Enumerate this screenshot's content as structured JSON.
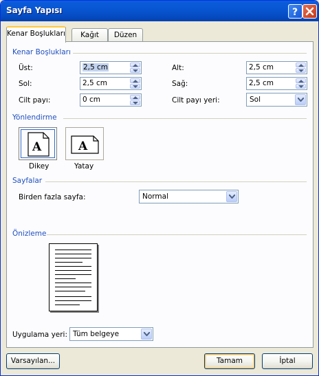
{
  "window": {
    "title": "Sayfa Yapısı"
  },
  "titlebar_buttons": {
    "help_glyph": "?",
    "close_glyph": "✕"
  },
  "tabs": [
    {
      "label": "Kenar Boşlukları",
      "active": true
    },
    {
      "label": "Kağıt",
      "active": false
    },
    {
      "label": "Düzen",
      "active": false
    }
  ],
  "margins": {
    "section_title": "Kenar Boşlukları",
    "top": {
      "label": "Üst:",
      "value": "2,5 cm"
    },
    "bottom": {
      "label": "Alt:",
      "value": "2,5 cm"
    },
    "left": {
      "label": "Sol:",
      "value": "2,5 cm"
    },
    "right": {
      "label": "Sağ:",
      "value": "2,5 cm"
    },
    "gutter": {
      "label": "Cilt payı:",
      "value": "0 cm"
    },
    "gutter_position": {
      "label": "Cilt payı yeri:",
      "value": "Sol"
    }
  },
  "orientation": {
    "section_title": "Yönlendirme",
    "portrait": {
      "label": "Dikey",
      "glyph": "A",
      "selected": true
    },
    "landscape": {
      "label": "Yatay",
      "glyph": "A",
      "selected": false
    }
  },
  "pages": {
    "section_title": "Sayfalar",
    "multiple_pages": {
      "label": "Birden fazla sayfa:",
      "value": "Normal"
    }
  },
  "preview": {
    "section_title": "Önizleme",
    "apply_to": {
      "label": "Uygulama yeri:",
      "value": "Tüm belgeye"
    }
  },
  "buttons": {
    "default_label": "Varsayılan...",
    "ok_label": "Tamam",
    "cancel_label": "İptal"
  },
  "colors": {
    "titlebar": "#0856d3",
    "section_text": "#1f4fbf",
    "close": "#c33a1a",
    "dialog_bg": "#ece9d8"
  }
}
